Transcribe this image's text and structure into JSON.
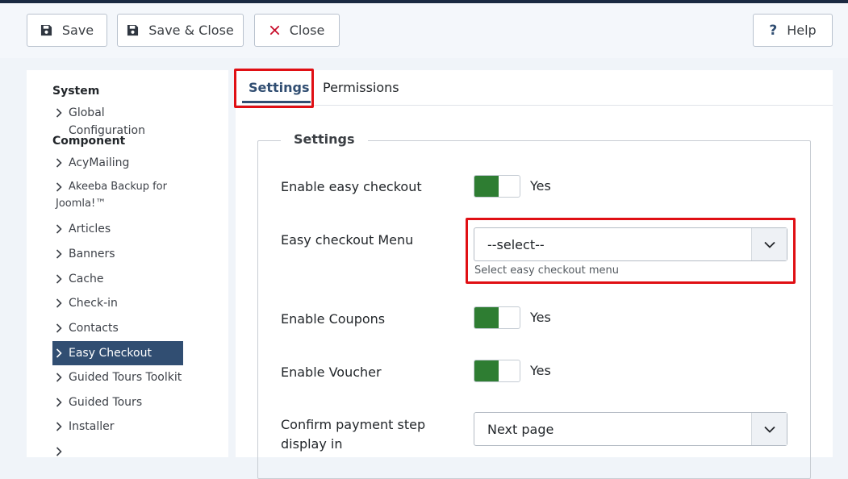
{
  "toolbar": {
    "save_label": "Save",
    "save_close_label": "Save & Close",
    "close_label": "Close",
    "help_label": "Help",
    "save_icon": "floppy-disk-icon",
    "close_icon": "x-icon",
    "help_icon": "question-icon",
    "save_icon_color": "#2f3640",
    "close_icon_color": "#c8102e"
  },
  "sidebar": {
    "system_heading": "System",
    "system_items": [
      {
        "label": "Global Configuration"
      }
    ],
    "component_heading": "Component",
    "component_items": [
      {
        "label": "AcyMailing"
      },
      {
        "label": "Akeeba Backup for",
        "label_line2": "Joomla!™"
      },
      {
        "label": "Articles"
      },
      {
        "label": "Banners"
      },
      {
        "label": "Cache"
      },
      {
        "label": "Check-in"
      },
      {
        "label": "Contacts"
      },
      {
        "label": "Easy Checkout",
        "active": true
      },
      {
        "label": "Guided Tours Toolkit"
      },
      {
        "label": "Guided Tours"
      },
      {
        "label": "Installer"
      }
    ],
    "active_color": "#314e72"
  },
  "tabs": [
    {
      "label": "Settings",
      "active": true
    },
    {
      "label": "Permissions",
      "active": false
    }
  ],
  "settings": {
    "legend": "Settings",
    "enable_easy_checkout": {
      "label": "Enable easy checkout",
      "value": "Yes"
    },
    "easy_checkout_menu": {
      "label": "Easy checkout Menu",
      "selected": "--select--",
      "help": "Select easy checkout menu"
    },
    "enable_coupons": {
      "label": "Enable Coupons",
      "value": "Yes"
    },
    "enable_voucher": {
      "label": "Enable Voucher",
      "value": "Yes"
    },
    "confirm_payment_step": {
      "label": "Confirm payment step display in",
      "selected": "Next page"
    },
    "toggle_on_color": "#2e7d32",
    "highlight_color": "#e00f14"
  }
}
